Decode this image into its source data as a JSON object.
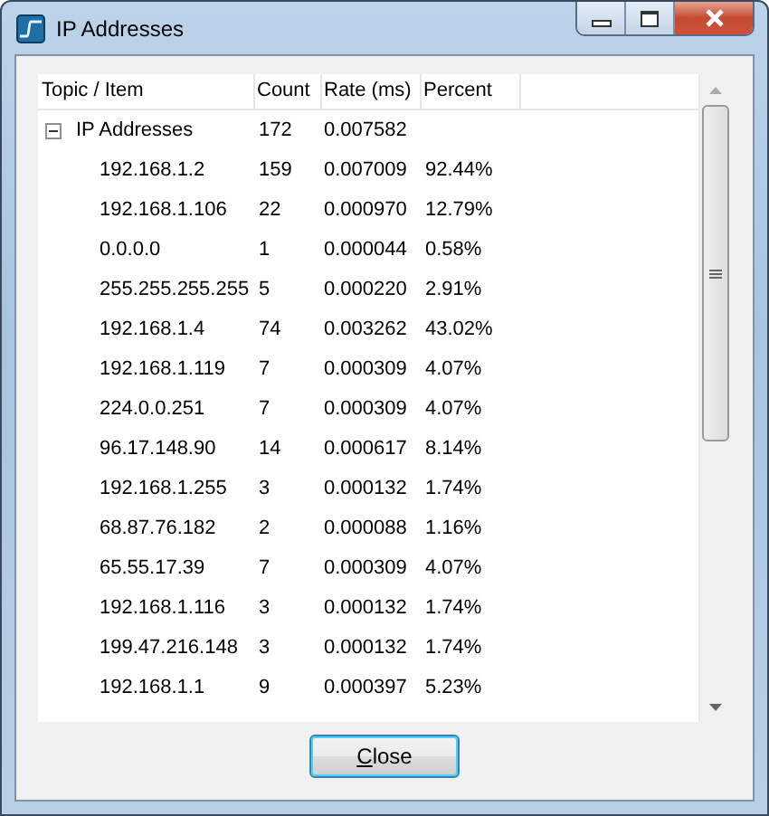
{
  "window": {
    "title": "IP Addresses"
  },
  "table": {
    "columns": [
      "Topic / Item",
      "Count",
      "Rate (ms)",
      "Percent"
    ],
    "rows": [
      {
        "cells": [
          "IP Addresses",
          "172",
          "0.007582",
          ""
        ],
        "expanded": true,
        "children": [
          {
            "cells": [
              "192.168.1.2",
              "159",
              "0.007009",
              "92.44%"
            ]
          },
          {
            "cells": [
              "192.168.1.106",
              "22",
              "0.000970",
              "12.79%"
            ]
          },
          {
            "cells": [
              "0.0.0.0",
              "1",
              "0.000044",
              "0.58%"
            ]
          },
          {
            "cells": [
              "255.255.255.255",
              "5",
              "0.000220",
              "2.91%"
            ]
          },
          {
            "cells": [
              "192.168.1.4",
              "74",
              "0.003262",
              "43.02%"
            ]
          },
          {
            "cells": [
              "192.168.1.119",
              "7",
              "0.000309",
              "4.07%"
            ]
          },
          {
            "cells": [
              "224.0.0.251",
              "7",
              "0.000309",
              "4.07%"
            ]
          },
          {
            "cells": [
              "96.17.148.90",
              "14",
              "0.000617",
              "8.14%"
            ]
          },
          {
            "cells": [
              "192.168.1.255",
              "3",
              "0.000132",
              "1.74%"
            ]
          },
          {
            "cells": [
              "68.87.76.182",
              "2",
              "0.000088",
              "1.16%"
            ]
          },
          {
            "cells": [
              "65.55.17.39",
              "7",
              "0.000309",
              "4.07%"
            ]
          },
          {
            "cells": [
              "192.168.1.116",
              "3",
              "0.000132",
              "1.74%"
            ]
          },
          {
            "cells": [
              "199.47.216.148",
              "3",
              "0.000132",
              "1.74%"
            ]
          },
          {
            "cells": [
              "192.168.1.1",
              "9",
              "0.000397",
              "5.23%"
            ]
          }
        ]
      }
    ]
  },
  "buttons": [
    {
      "label": "Close",
      "default": true
    }
  ]
}
